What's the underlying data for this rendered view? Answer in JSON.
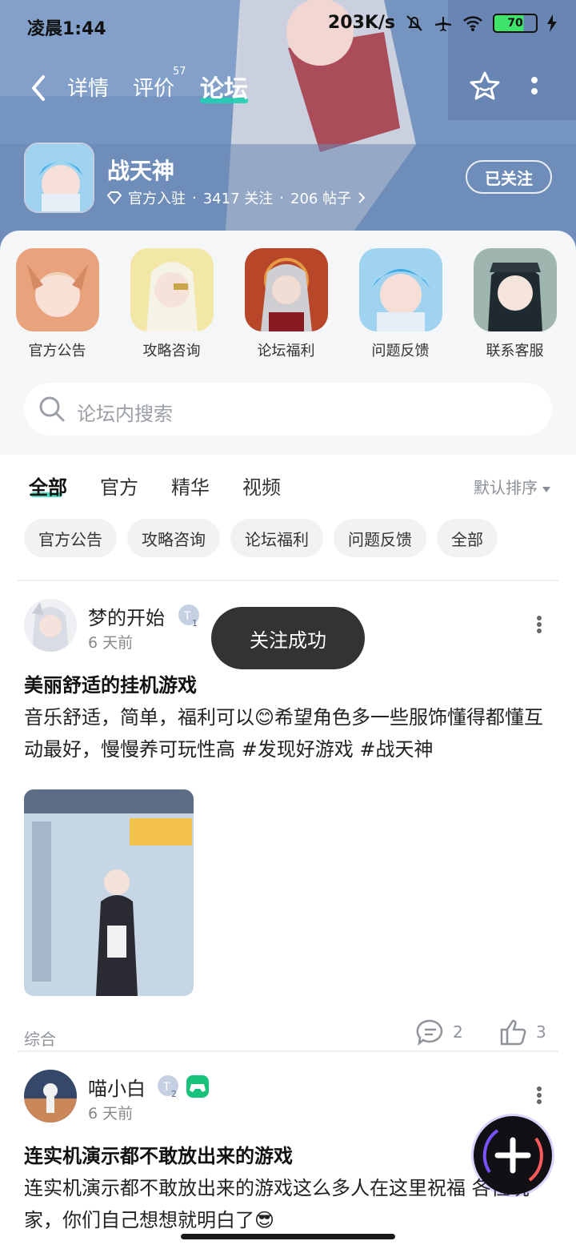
{
  "status_bar": {
    "time": "凌晨1:44",
    "net_speed": "203K/s",
    "battery": "70"
  },
  "nav": {
    "tabs": [
      "详情",
      "评价",
      "论坛"
    ],
    "review_count": "57",
    "active_tab": "论坛"
  },
  "forum": {
    "name": "战天神",
    "meta_prefix": "官方入驻",
    "followers": "3417 关注",
    "posts": "206 帖子",
    "follow_button": "已关注"
  },
  "shortcuts": [
    {
      "label": "官方公告"
    },
    {
      "label": "攻略咨询"
    },
    {
      "label": "论坛福利"
    },
    {
      "label": "问题反馈"
    },
    {
      "label": "联系客服"
    }
  ],
  "search": {
    "placeholder": "论坛内搜索"
  },
  "category_tabs": [
    "全部",
    "官方",
    "精华",
    "视频"
  ],
  "sort_label": "默认排序",
  "chips": [
    "官方公告",
    "攻略咨询",
    "论坛福利",
    "问题反馈",
    "全部"
  ],
  "posts": [
    {
      "user": "梦的开始",
      "time": "6 天前",
      "title": "美丽舒适的挂机游戏",
      "body": "音乐舒适，简单，福利可以😊希望角色多一些服饰懂得都懂互动最好，慢慢养可玩性高 #发现好游戏  #战天神",
      "tag": "综合",
      "comments": "2",
      "likes": "3",
      "level": "1"
    },
    {
      "user": "喵小白",
      "time": "6 天前",
      "title": "连实机演示都不敢放出来的游戏",
      "body": "连实机演示都不敢放出来的游戏这么多人在这里祝福 各位玩家，你们自己想想就明白了😎",
      "level": "2"
    }
  ],
  "toast": "关注成功",
  "colors": {
    "accent": "#1fcfb3",
    "toast_bg": "#333333",
    "banner": "#7391bd"
  }
}
